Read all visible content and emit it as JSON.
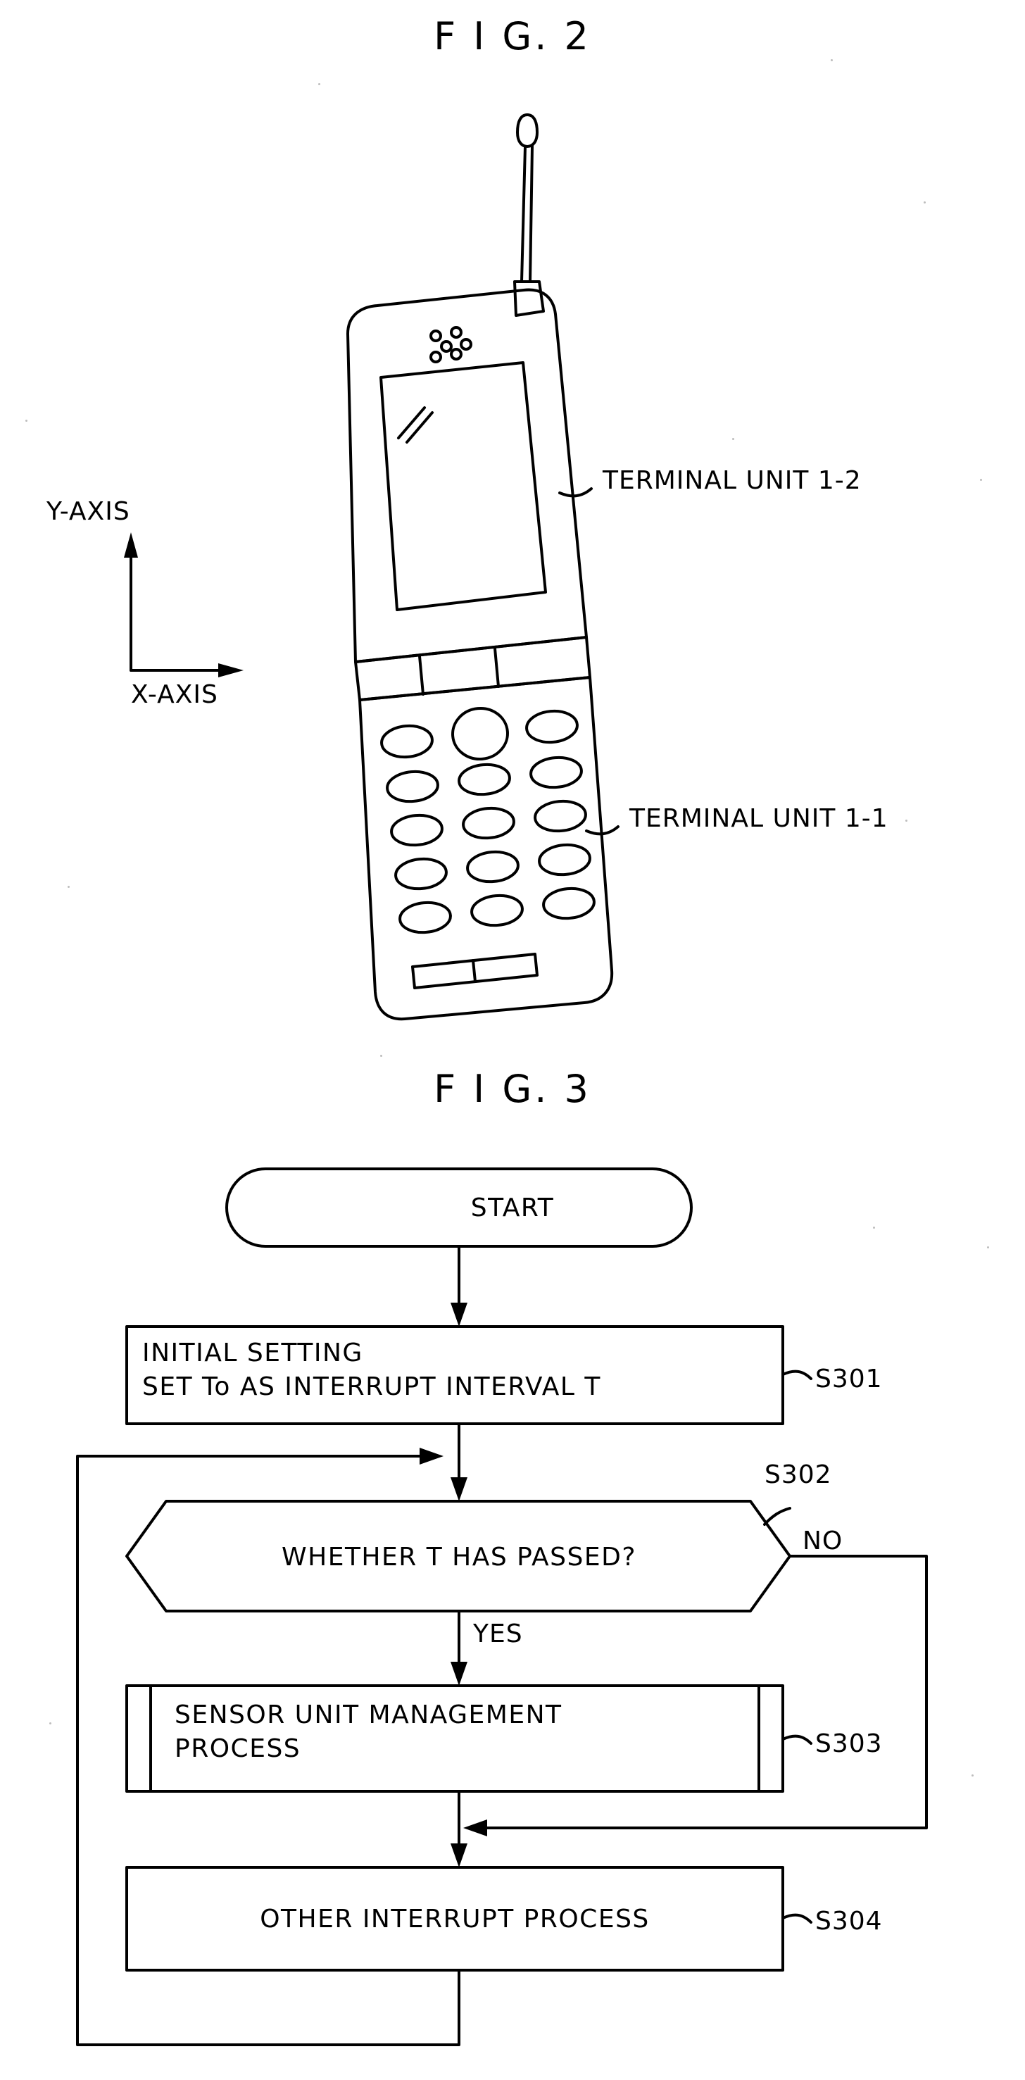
{
  "figures": {
    "fig2": {
      "title": "F I G. 2",
      "axis": {
        "y_label": "Y-AXIS",
        "x_label": "X-AXIS"
      },
      "callouts": [
        {
          "text": "TERMINAL UNIT 1-2"
        },
        {
          "text": "TERMINAL UNIT 1-1"
        }
      ]
    },
    "fig3": {
      "title": "F I G. 3",
      "nodes": [
        {
          "id": "start",
          "shape": "stadium",
          "text": "START"
        },
        {
          "id": "s301",
          "shape": "rect",
          "text": "INITIAL SETTING\nSET To AS INTERRUPT INTERVAL T",
          "step": "S301"
        },
        {
          "id": "s302",
          "shape": "hexagon",
          "text": "WHETHER T HAS PASSED?",
          "step": "S302"
        },
        {
          "id": "s303",
          "shape": "subroutine",
          "text": "SENSOR UNIT MANAGEMENT\nPROCESS",
          "step": "S303"
        },
        {
          "id": "s304",
          "shape": "rect",
          "text": "OTHER INTERRUPT PROCESS",
          "step": "S304"
        }
      ],
      "edge_labels": {
        "no": "NO",
        "yes": "YES"
      }
    }
  },
  "colors": {
    "ink": "#000000",
    "paper": "#ffffff",
    "speck": "#bdbdbd"
  }
}
